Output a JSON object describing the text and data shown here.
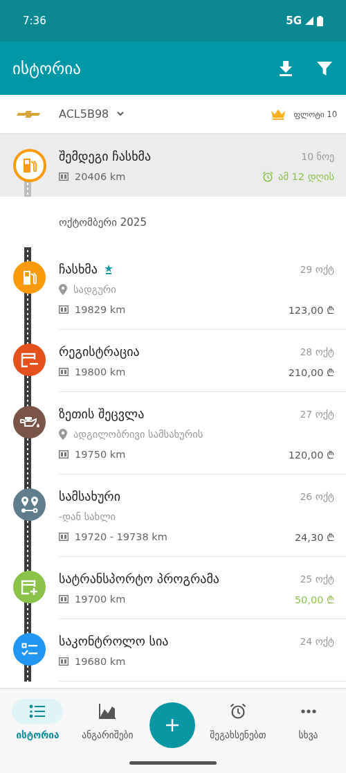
{
  "status_bar": {
    "time": "7:36",
    "network": "5G"
  },
  "app_bar": {
    "title": "ისტორია"
  },
  "vehicle": {
    "plate": "ACL5B98",
    "fleet": "ფლოტი 10"
  },
  "upcoming": {
    "kind": "fuel",
    "title": "შემდეგი ჩასხმა",
    "date": "10 ნოე",
    "odometer": "20406 km",
    "due": "ამ 12 დღის"
  },
  "month_header": "ოქტომბერი 2025",
  "entries": [
    {
      "kind": "fuel",
      "color": "#fb9b0b",
      "title": "ჩასხმა",
      "starred": true,
      "date": "29 ოქტ",
      "location": "სადგური",
      "odometer": "19829 km",
      "amount": "123,00 ₾",
      "income": false
    },
    {
      "kind": "registration",
      "color": "#e4511d",
      "title": "რეგისტრაცია",
      "starred": false,
      "date": "28 ოქტ",
      "odometer": "19800 km",
      "amount": "210,00 ₾",
      "income": false
    },
    {
      "kind": "oil",
      "color": "#7a5446",
      "title": "ზეთის შეცვლა",
      "starred": false,
      "date": "27 ოქტ",
      "location": "ადგილობრივი სამსახურის",
      "odometer": "19750 km",
      "amount": "120,00 ₾",
      "income": false
    },
    {
      "kind": "trip",
      "color": "#5f7d8d",
      "title": "სამსახური",
      "starred": false,
      "date": "26 ოქტ",
      "subtitle": "-დან სახლი",
      "odometer": "19720 - 19738 km",
      "amount": "24,30 ₾",
      "income": false
    },
    {
      "kind": "income",
      "color": "#8bc34a",
      "title": "სატრანსპორტო პროგრამა",
      "starred": false,
      "date": "25 ოქტ",
      "odometer": "19700 km",
      "amount": "50,00 ₾",
      "income": true
    },
    {
      "kind": "checklist",
      "color": "#2196f3",
      "title": "საკონტროლო სია",
      "starred": false,
      "date": "24 ოქტ",
      "odometer": "19680 km"
    }
  ],
  "bottom_nav": [
    {
      "kind": "list",
      "label": "ისტორია",
      "selected": true
    },
    {
      "kind": "chart",
      "label": "ანგარიშები",
      "selected": false
    },
    {
      "kind": "add"
    },
    {
      "kind": "alarm",
      "label": "შეგახსენებთ",
      "selected": false
    },
    {
      "kind": "more",
      "label": "სხვა",
      "selected": false
    }
  ]
}
